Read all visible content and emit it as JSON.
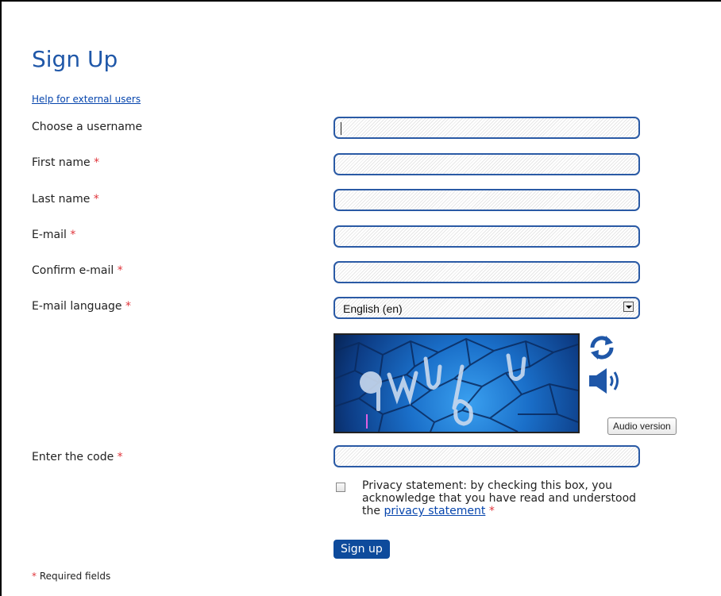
{
  "page": {
    "title": "Sign Up",
    "help_link": "Help for external users",
    "required_marker": "*"
  },
  "fields": {
    "username": {
      "label": "Choose a username",
      "value": ""
    },
    "first_name": {
      "label": "First name",
      "value": ""
    },
    "last_name": {
      "label": "Last name",
      "value": ""
    },
    "email": {
      "label": "E-mail",
      "value": ""
    },
    "confirm_email": {
      "label": "Confirm e-mail",
      "value": ""
    },
    "email_language": {
      "label": "E-mail language",
      "selected": "English (en)"
    },
    "code": {
      "label": "Enter the code",
      "value": ""
    }
  },
  "captcha": {
    "audio_button": "Audio version",
    "refresh_icon": "refresh-icon",
    "audio_icon": "speaker-icon"
  },
  "privacy": {
    "text": "Privacy statement: by checking this box, you acknowledge that you have read and understood the",
    "link": "privacy statement",
    "checked": false
  },
  "actions": {
    "signup": "Sign up"
  },
  "footer": {
    "required_note": "Required fields"
  },
  "colors": {
    "accent": "#1f57a8",
    "field_border": "#2a5aa5",
    "required": "#e0353b",
    "button_bg": "#0e4b9c",
    "link": "#0645ad"
  }
}
